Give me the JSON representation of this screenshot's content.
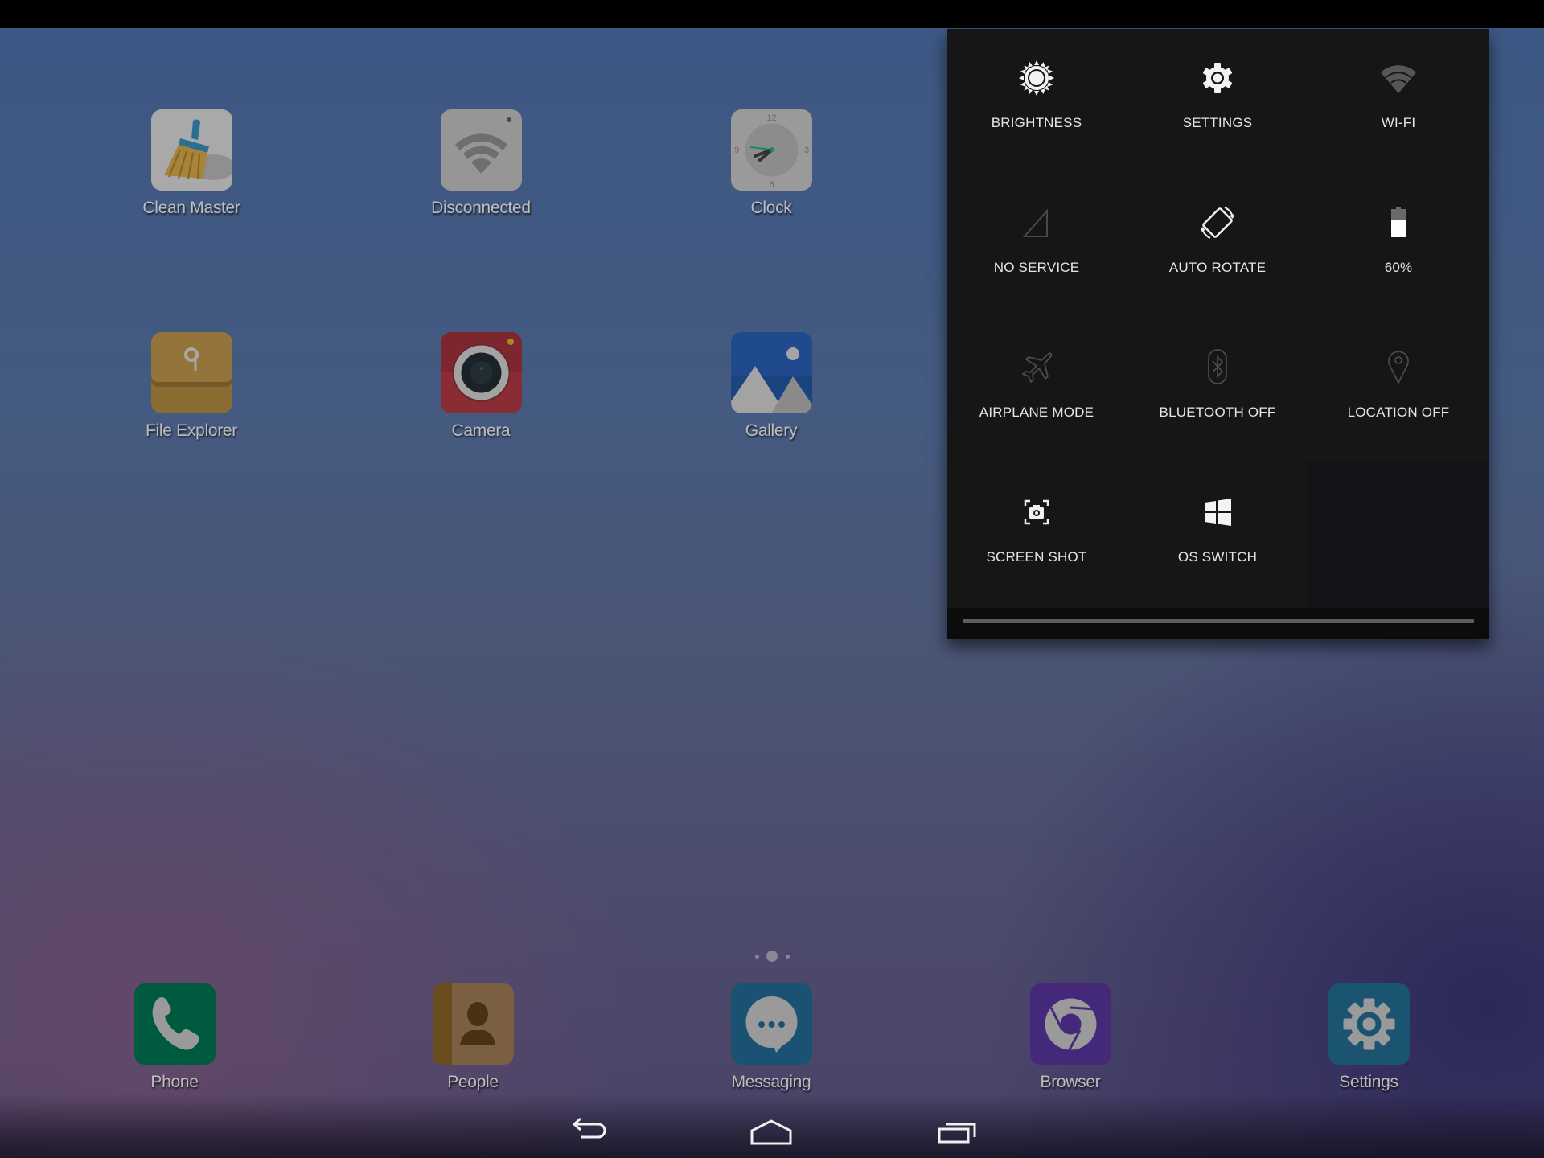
{
  "home": {
    "apps": [
      {
        "label": "Clean Master",
        "icon": "broom-icon"
      },
      {
        "label": "Disconnected",
        "icon": "wifi-widget-icon"
      },
      {
        "label": "Clock",
        "icon": "clock-icon"
      },
      {
        "label": "File Explorer",
        "icon": "folder-icon"
      },
      {
        "label": "Camera",
        "icon": "camera-icon"
      },
      {
        "label": "Gallery",
        "icon": "gallery-icon"
      }
    ],
    "clock_numerals": [
      "12",
      "3",
      "6",
      "9"
    ]
  },
  "quick_settings": {
    "tiles": [
      {
        "label": "BRIGHTNESS",
        "icon": "brightness-icon",
        "active": true
      },
      {
        "label": "SETTINGS",
        "icon": "gear-icon",
        "active": true
      },
      {
        "label": "WI-FI",
        "icon": "wifi-icon",
        "active": false
      },
      {
        "label": "NO SERVICE",
        "icon": "signal-icon",
        "active": false
      },
      {
        "label": "AUTO ROTATE",
        "icon": "rotate-icon",
        "active": true
      },
      {
        "label": "60%",
        "icon": "battery-icon",
        "active": true
      },
      {
        "label": "AIRPLANE MODE",
        "icon": "airplane-icon",
        "active": false
      },
      {
        "label": "BLUETOOTH OFF",
        "icon": "bluetooth-icon",
        "active": false
      },
      {
        "label": "LOCATION OFF",
        "icon": "location-icon",
        "active": false
      },
      {
        "label": "SCREEN SHOT",
        "icon": "screenshot-icon",
        "active": true
      },
      {
        "label": "OS SWITCH",
        "icon": "windows-icon",
        "active": true
      }
    ],
    "battery_level": 0.6
  },
  "pager": {
    "pages": 3,
    "current": 2
  },
  "dock": {
    "apps": [
      {
        "label": "Phone",
        "icon": "phone-icon"
      },
      {
        "label": "People",
        "icon": "contacts-icon"
      },
      {
        "label": "Messaging",
        "icon": "message-icon"
      },
      {
        "label": "Browser",
        "icon": "chrome-icon"
      },
      {
        "label": "Settings",
        "icon": "gear-icon"
      }
    ]
  },
  "nav": {
    "buttons": [
      "back",
      "home",
      "recents"
    ]
  },
  "colors": {
    "phone": "#005a40",
    "people": "#7a6040",
    "messaging": "#1b5274",
    "browser": "#44287a",
    "settings": "#1b5470",
    "camera": "#8a2c34",
    "gallery": "#1f4a8e",
    "file_explorer": "#8a6c32",
    "panel": "#161616"
  }
}
